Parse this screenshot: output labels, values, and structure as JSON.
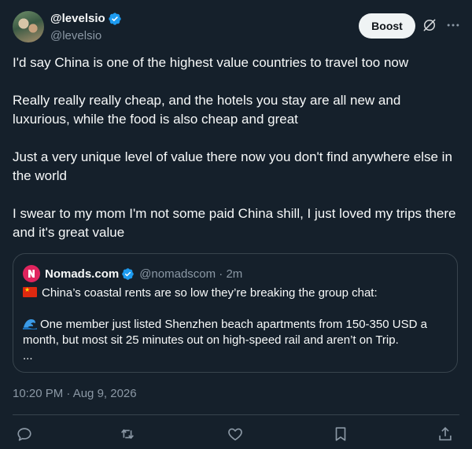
{
  "author": {
    "display_name": "@levelsio",
    "handle": "@levelsio",
    "verified": true,
    "avatar_icon": "profile-photo"
  },
  "header": {
    "boost_label": "Boost",
    "grok_icon": "grok-icon",
    "more_icon": "more-icon"
  },
  "body": {
    "paragraphs": [
      "I'd say China is one of the highest value countries to travel too now",
      "Really really really cheap, and the hotels you stay are all new and luxurious, while the food is also cheap and great",
      "Just a very unique level of value there now you don't find anywhere else in the world",
      "I swear to my mom I'm not some paid China shill, I just loved my trips there and it's great value"
    ]
  },
  "quote": {
    "display_name": "Nomads.com",
    "handle_time": "@nomadscom · 2m",
    "verified": true,
    "line1": "China’s coastal rents are so low they’re breaking the group chat:",
    "line2": "One member just listed Shenzhen beach apartments from 150-350 USD a",
    "line3": "month, but most sit 25 minutes out on high-speed rail and aren’t on Trip.",
    "line4": "..."
  },
  "timestamp": "10:20 PM · Aug 9, 2026",
  "actions": [
    "reply-icon",
    "repost-icon",
    "like-icon",
    "bookmark-icon",
    "share-icon"
  ],
  "colors": {
    "background": "#15202b",
    "text": "#f7f9f9",
    "muted": "#8b98a5",
    "border": "#38444d",
    "verified": "#1d9bf0",
    "boost_bg": "#eff3f4"
  }
}
